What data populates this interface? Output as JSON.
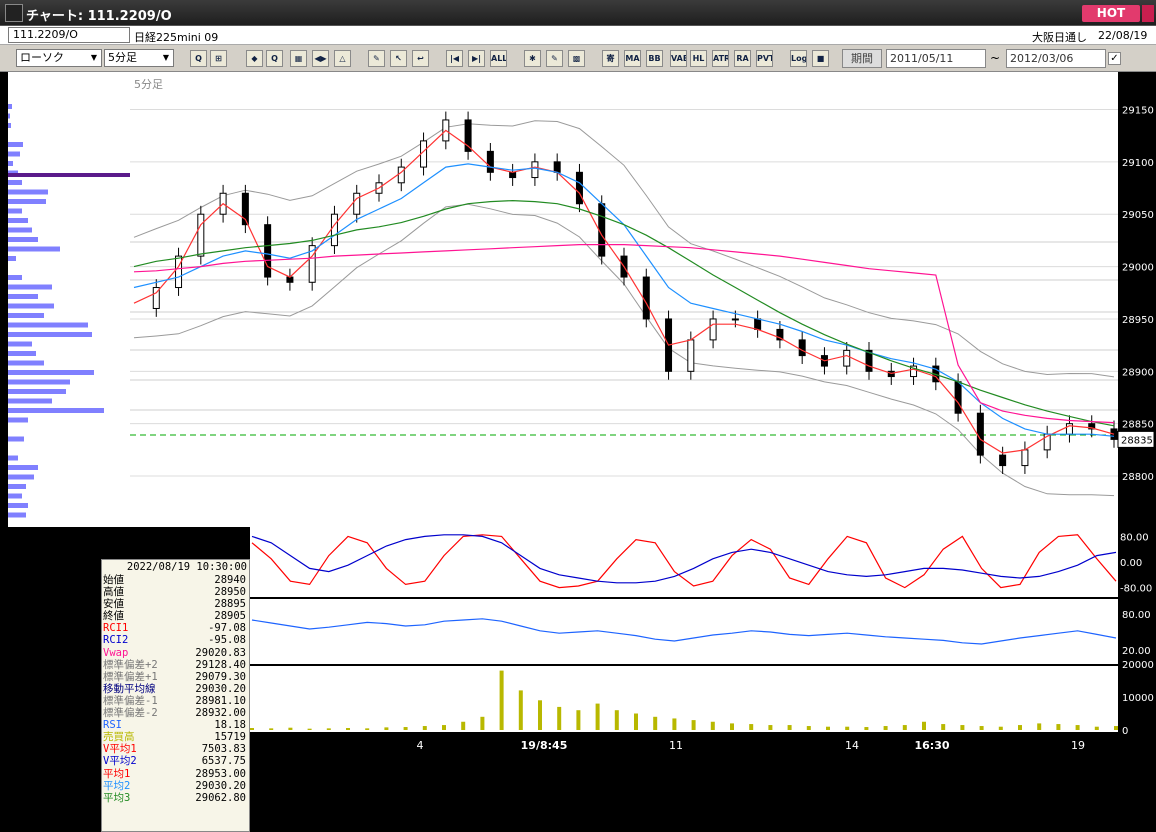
{
  "window": {
    "title": "チャート: 111.2209/O",
    "hot_label": "HOT"
  },
  "toolbar1": {
    "symbol_code": "111.2209/O",
    "symbol_name": "日経225mini 09",
    "market": "大阪日通し",
    "date": "22/08/19"
  },
  "toolbar2": {
    "chart_type": "ローソク",
    "interval": "5分足",
    "period_label": "期間",
    "date_from": "2011/05/11",
    "date_to": "2012/03/06",
    "tilde": "~",
    "check_mark": "✓",
    "dropdown_glyph": "▼",
    "buttons": [
      "Q",
      "⊞",
      "◆",
      "Q",
      "▦",
      "◀▶",
      "△",
      "✎",
      "↖",
      "↩",
      "|◀",
      "▶|",
      "ALL",
      "✱",
      "✎",
      "▩",
      "寄",
      "MA",
      "BB",
      "VAE",
      "HL",
      "ATR",
      "RA",
      "PVT",
      "Log",
      "■"
    ]
  },
  "chart": {
    "panel_label": "5分足",
    "price_box": "28835",
    "price_levels": [
      "29150",
      "29100",
      "29050",
      "29000",
      "28950",
      "28900",
      "28850",
      "28800"
    ],
    "rci_levels": [
      "80.00",
      "0.00",
      "-80.00"
    ],
    "rsi_levels": [
      "80.00",
      "20.00"
    ],
    "volume_levels": [
      "20000",
      "10000",
      "0"
    ],
    "x_labels": [
      "4",
      "19/8:45",
      "11",
      "14",
      "16:30",
      "19"
    ],
    "colors": {
      "candle": "#ffffff",
      "ma_short": "#ff3333",
      "ma_mid": "#1e90ff",
      "ma_long": "#228b22",
      "vwap": "#ff1493",
      "bands": "#9a9a9a",
      "rci1": "#ff0000",
      "rci2": "#0000cc",
      "rsi": "#1e64ff",
      "volume": "#b8b800",
      "ref_line": "#00aa00"
    }
  },
  "chart_data": {
    "type": "line",
    "title": "5分足",
    "x_ticks": [
      "4",
      "19/8:45",
      "11",
      "14",
      "16:30",
      "19"
    ],
    "ylim": [
      28780,
      29160
    ],
    "series": [
      {
        "values": [
          28960,
          28980,
          29010,
          29050,
          29070,
          29040,
          28990,
          28985,
          29020,
          29050,
          29070,
          29080,
          29095,
          29120,
          29140,
          29110,
          29090,
          29085,
          29100,
          29090,
          29060,
          29010,
          28990,
          28950,
          28900,
          28930,
          28950,
          28950,
          28940,
          28930,
          28915,
          28905,
          28920,
          28900,
          28895,
          28905,
          28890,
          28860,
          28820,
          28810,
          28825,
          28840,
          28850,
          28845,
          28835
        ]
      },
      {
        "name": "平均1",
        "values": [
          28965,
          28975,
          29000,
          29040,
          29060,
          29045,
          29000,
          28990,
          29010,
          29040,
          29065,
          29075,
          29090,
          29110,
          29130,
          29115,
          29095,
          29090,
          29095,
          29090,
          29070,
          29030,
          29000,
          28965,
          28925,
          28930,
          28945,
          28945,
          28940,
          28932,
          28920,
          28910,
          28915,
          28905,
          28898,
          28902,
          28895,
          28870,
          28835,
          28822,
          28825,
          28838,
          28848,
          28846,
          28840
        ]
      },
      {
        "name": "平均2",
        "values": [
          28980,
          28985,
          28990,
          29000,
          29010,
          29015,
          29012,
          29008,
          29015,
          29030,
          29045,
          29055,
          29065,
          29080,
          29095,
          29098,
          29095,
          29092,
          29094,
          29090,
          29080,
          29060,
          29040,
          29010,
          28980,
          28965,
          28960,
          28955,
          28950,
          28945,
          28938,
          28930,
          28925,
          28918,
          28912,
          28908,
          28902,
          28890,
          28870,
          28855,
          28845,
          28840,
          28840,
          28840,
          28838
        ]
      },
      {
        "name": "平均3",
        "values": [
          29000,
          29005,
          29008,
          29012,
          29015,
          29018,
          29020,
          29022,
          29025,
          29030,
          29035,
          29038,
          29042,
          29048,
          29055,
          29060,
          29062,
          29063,
          29062,
          29060,
          29055,
          29048,
          29040,
          29030,
          29018,
          29005,
          28992,
          28980,
          28968,
          28956,
          28945,
          28935,
          28926,
          28918,
          28910,
          28903,
          28897,
          28890,
          28882,
          28875,
          28868,
          28862,
          28857,
          28852,
          28848
        ]
      },
      {
        "name": "Vwap",
        "values": [
          28995,
          28996,
          28998,
          29000,
          29003,
          29005,
          29006,
          29007,
          29008,
          29010,
          29011,
          29012,
          29013,
          29014,
          29015,
          29016,
          29017,
          29018,
          29019,
          29020,
          29021,
          29021,
          29021,
          29020,
          29019,
          29018,
          29016,
          29014,
          29012,
          29010,
          29007,
          29004,
          29001,
          28998,
          28996,
          28994,
          28992,
          28906,
          28870,
          28862,
          28858,
          28855,
          28853,
          28852,
          28851
        ]
      }
    ],
    "rci_series": [
      {
        "name": "RCI1",
        "values": [
          60,
          10,
          -60,
          -70,
          20,
          80,
          60,
          -20,
          -70,
          -60,
          20,
          80,
          85,
          80,
          10,
          -60,
          -80,
          -75,
          -60,
          10,
          70,
          60,
          -30,
          -75,
          -60,
          20,
          70,
          40,
          -50,
          -70,
          10,
          80,
          60,
          -50,
          -80,
          -40,
          40,
          80,
          -20,
          -80,
          -70,
          30,
          80,
          85,
          10,
          -60
        ]
      },
      {
        "name": "RCI2",
        "values": [
          80,
          60,
          20,
          -20,
          -30,
          -10,
          20,
          50,
          70,
          80,
          85,
          85,
          80,
          60,
          20,
          -20,
          -40,
          -50,
          -60,
          -65,
          -65,
          -60,
          -45,
          -20,
          10,
          30,
          40,
          30,
          10,
          -10,
          -30,
          -40,
          -45,
          -40,
          -30,
          -20,
          -20,
          -25,
          -35,
          -45,
          -50,
          -45,
          -30,
          -10,
          20,
          30
        ]
      }
    ],
    "rsi_series": [
      {
        "name": "RSI",
        "values": [
          70,
          65,
          60,
          55,
          58,
          62,
          66,
          64,
          60,
          62,
          68,
          70,
          72,
          68,
          60,
          52,
          48,
          50,
          52,
          48,
          44,
          38,
          35,
          40,
          45,
          48,
          52,
          50,
          46,
          44,
          46,
          48,
          45,
          42,
          40,
          38,
          36,
          32,
          30,
          35,
          40,
          44,
          48,
          52,
          46,
          40
        ]
      }
    ],
    "volume_series": [
      {
        "name": "売買高",
        "values": [
          600,
          500,
          700,
          400,
          500,
          600,
          500,
          800,
          900,
          1200,
          1500,
          2500,
          4000,
          18000,
          12000,
          9000,
          7000,
          6000,
          8000,
          6000,
          5000,
          4000,
          3500,
          3000,
          2500,
          2000,
          1800,
          1500,
          1500,
          1200,
          1000,
          1000,
          900,
          1200,
          1500,
          2500,
          1800,
          1500,
          1200,
          1000,
          1500,
          2000,
          1800,
          1500,
          1000,
          1200
        ]
      }
    ],
    "legend_position": "bottom-left"
  },
  "info": {
    "datetime": "2022/08/19 10:30:00",
    "rows": [
      {
        "label": "始値",
        "value": "28940",
        "color": "#000000"
      },
      {
        "label": "高値",
        "value": "28950",
        "color": "#000000"
      },
      {
        "label": "安値",
        "value": "28895",
        "color": "#000000"
      },
      {
        "label": "終値",
        "value": "28905",
        "color": "#000000"
      },
      {
        "label": "RCI1",
        "value": "-97.08",
        "color": "#ff0000"
      },
      {
        "label": "RCI2",
        "value": "-95.08",
        "color": "#0000cc"
      },
      {
        "label": "Vwap",
        "value": "29020.83",
        "color": "#ff1493"
      },
      {
        "label": "標準偏差+2",
        "value": "29128.40",
        "color": "#777777"
      },
      {
        "label": "標準偏差+1",
        "value": "29079.30",
        "color": "#777777"
      },
      {
        "label": "移動平均線",
        "value": "29030.20",
        "color": "#000080"
      },
      {
        "label": "標準偏差-1",
        "value": "28981.10",
        "color": "#777777"
      },
      {
        "label": "標準偏差-2",
        "value": "28932.00",
        "color": "#777777"
      },
      {
        "label": "RSI",
        "value": "18.18",
        "color": "#1e64ff"
      },
      {
        "label": "売買高",
        "value": "15719",
        "color": "#b8b800"
      },
      {
        "label": "V平均1",
        "value": "7503.83",
        "color": "#ff0000"
      },
      {
        "label": "V平均2",
        "value": "6537.75",
        "color": "#0000cc"
      },
      {
        "label": "平均1",
        "value": "28953.00",
        "color": "#ff0000"
      },
      {
        "label": "平均2",
        "value": "29030.20",
        "color": "#1e90ff"
      },
      {
        "label": "平均3",
        "value": "29062.80",
        "color": "#228b22"
      }
    ]
  }
}
